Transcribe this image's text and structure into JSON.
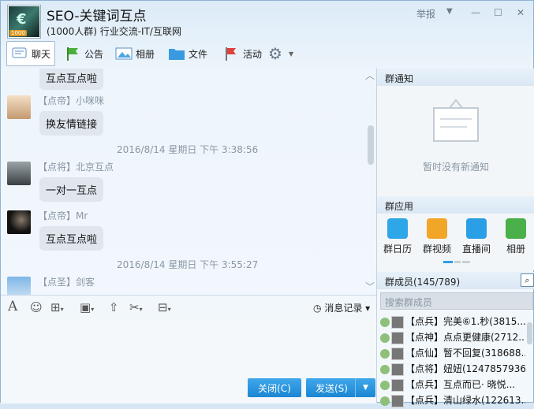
{
  "header": {
    "title": "SEO-关键词互点",
    "subtitle": "(1000人群) 行业交流-IT/互联网",
    "report": "举报",
    "badge": "1000"
  },
  "toolbar": {
    "chat": "聊天",
    "announce": "公告",
    "album": "相册",
    "files": "文件",
    "activity": "活动"
  },
  "messages": [
    {
      "text": "互点互点啦"
    },
    {
      "name": "【点帝】小咪咪",
      "text": "换友情链接"
    },
    {
      "time": "2016/8/14 星期日 下午 3:38:56"
    },
    {
      "name": "【点将】北京互点",
      "text": "一对一互点"
    },
    {
      "name": "【点帝】Mr",
      "text": "互点互点啦"
    },
    {
      "time": "2016/8/14 星期日 下午 3:55:27"
    },
    {
      "name": "【点圣】剑客"
    }
  ],
  "input": {
    "history": "消息记录",
    "close": "关闭(C)",
    "send": "发送(S)"
  },
  "sidebar": {
    "notice_title": "群通知",
    "notice_empty": "暂时没有新通知",
    "apps_title": "群应用",
    "apps": [
      "群日历",
      "群视频",
      "直播间",
      "相册"
    ],
    "members_title": "群成员(145/789)",
    "search_placeholder": "搜索群成员",
    "members": [
      "【点兵】完美⑥1.秒(3815...",
      "【点神】点点更健康(2712...",
      "【点仙】暂不回复(318688...",
      "【点将】妞妞(1247857936)",
      "【点兵】互点而已· 晓悦...",
      "【点兵】清山绿水(122613..."
    ]
  },
  "colors": {
    "accent": "#1d86d3",
    "bubble": "#dfe6ee"
  }
}
